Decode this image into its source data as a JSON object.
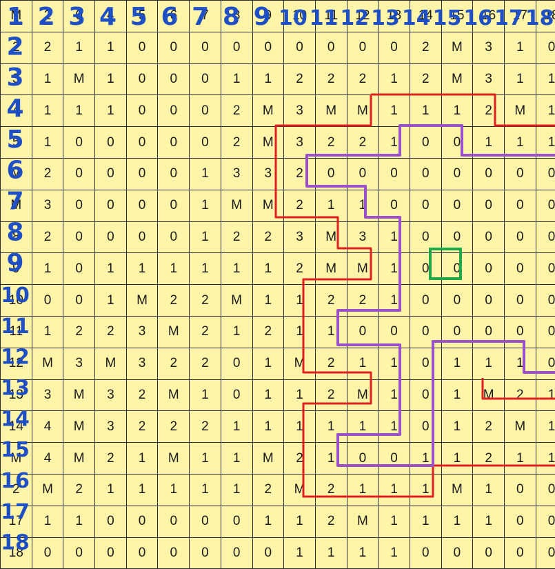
{
  "grid": {
    "rows": [
      [
        "M",
        "2",
        "0",
        "4",
        "5",
        "6",
        "7",
        "8",
        "9",
        "10",
        "11",
        "12",
        "13",
        "14",
        "15",
        "16",
        "17",
        "18"
      ],
      [
        "2",
        "2",
        "1",
        "1",
        "0",
        "0",
        "0",
        "0",
        "0",
        "0",
        "0",
        "0",
        "0",
        "2",
        "M",
        "3",
        "1",
        "0"
      ],
      [
        "3",
        "1",
        "M",
        "1",
        "0",
        "0",
        "0",
        "1",
        "1",
        "2",
        "2",
        "2",
        "1",
        "2",
        "M",
        "3",
        "1",
        "1"
      ],
      [
        "4",
        "1",
        "1",
        "1",
        "0",
        "0",
        "0",
        "2",
        "M",
        "3",
        "M",
        "M",
        "1",
        "1",
        "1",
        "2",
        "M",
        "1"
      ],
      [
        "5",
        "1",
        "0",
        "0",
        "0",
        "0",
        "0",
        "2",
        "M",
        "3",
        "2",
        "2",
        "1",
        "0",
        "0",
        "1",
        "1",
        "1"
      ],
      [
        "M",
        "2",
        "0",
        "0",
        "0",
        "0",
        "1",
        "3",
        "3",
        "2",
        "0",
        "0",
        "0",
        "0",
        "0",
        "0",
        "0",
        "0"
      ],
      [
        "M",
        "3",
        "0",
        "0",
        "0",
        "0",
        "1",
        "M",
        "M",
        "2",
        "1",
        "1",
        "0",
        "0",
        "0",
        "0",
        "0",
        "0"
      ],
      [
        "8",
        "2",
        "0",
        "0",
        "0",
        "0",
        "1",
        "2",
        "2",
        "3",
        "M",
        "3",
        "1",
        "0",
        "0",
        "0",
        "0",
        "0"
      ],
      [
        "9",
        "1",
        "0",
        "1",
        "1",
        "1",
        "1",
        "1",
        "1",
        "2",
        "M",
        "M",
        "1",
        "0",
        "0",
        "0",
        "0",
        "0"
      ],
      [
        "10",
        "0",
        "0",
        "1",
        "M",
        "2",
        "2",
        "M",
        "1",
        "1",
        "2",
        "2",
        "1",
        "0",
        "0",
        "0",
        "0",
        "0"
      ],
      [
        "11",
        "1",
        "2",
        "2",
        "3",
        "M",
        "2",
        "1",
        "2",
        "1",
        "1",
        "0",
        "0",
        "0",
        "0",
        "0",
        "0",
        "0"
      ],
      [
        "12",
        "M",
        "3",
        "M",
        "3",
        "2",
        "2",
        "0",
        "1",
        "M",
        "2",
        "1",
        "1",
        "0",
        "1",
        "1",
        "1",
        "0"
      ],
      [
        "13",
        "3",
        "M",
        "3",
        "2",
        "M",
        "1",
        "0",
        "1",
        "1",
        "2",
        "M",
        "1",
        "0",
        "1",
        "M",
        "2",
        "1"
      ],
      [
        "14",
        "4",
        "M",
        "3",
        "2",
        "2",
        "2",
        "1",
        "1",
        "1",
        "1",
        "1",
        "1",
        "0",
        "1",
        "2",
        "M",
        "1"
      ],
      [
        "M",
        "4",
        "M",
        "2",
        "1",
        "M",
        "1",
        "1",
        "M",
        "2",
        "1",
        "0",
        "0",
        "1",
        "1",
        "2",
        "1",
        "1"
      ],
      [
        "2",
        "M",
        "2",
        "1",
        "1",
        "1",
        "1",
        "1",
        "2",
        "M",
        "2",
        "1",
        "1",
        "1",
        "M",
        "1",
        "0",
        "0"
      ],
      [
        "17",
        "1",
        "1",
        "0",
        "0",
        "0",
        "0",
        "0",
        "1",
        "1",
        "2",
        "M",
        "1",
        "1",
        "1",
        "1",
        "0",
        "0"
      ],
      [
        "18",
        "0",
        "0",
        "0",
        "0",
        "0",
        "0",
        "0",
        "0",
        "1",
        "1",
        "1",
        "1",
        "0",
        "0",
        "0",
        "0",
        "0"
      ]
    ]
  },
  "annotations": {
    "column_numbers": [
      "1",
      "2",
      "3",
      "4",
      "5",
      "6",
      "7",
      "8",
      "9",
      "10",
      "11",
      "12",
      "13",
      "14",
      "15",
      "16",
      "17",
      "18"
    ],
    "row_numbers": [
      "2",
      "3",
      "4",
      "5",
      "6",
      "7",
      "8",
      "9",
      "10",
      "11",
      "12",
      "13",
      "14",
      "15",
      "16",
      "17",
      "18"
    ],
    "red_color": "#e02020",
    "purple_color": "#9b4fc8",
    "green_color": "#1fa84a",
    "blue_color": "#1f4fc4"
  }
}
